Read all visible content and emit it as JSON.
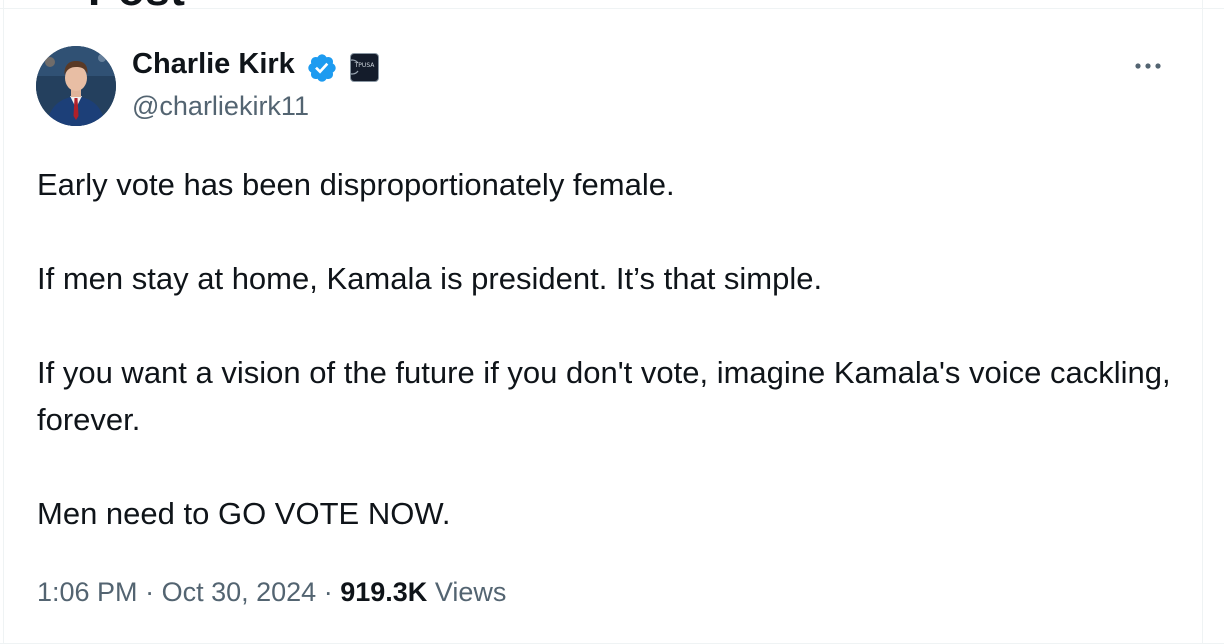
{
  "header": {
    "title": "Post"
  },
  "author": {
    "display_name": "Charlie Kirk",
    "handle": "@charliekirk11",
    "verified_icon": "verified-badge-icon",
    "affiliate_icon": "affiliate-badge-icon",
    "affiliate_badge_text": "TPUSA"
  },
  "actions": {
    "more_icon": "more-dots-icon"
  },
  "tweet": {
    "paragraphs": [
      "Early vote has been disproportionately female.",
      "If men stay at home, Kamala is president. It’s that simple.",
      "If you want a vision of the future if you don't vote, imagine Kamala's voice cackling, forever.",
      "Men need to GO VOTE NOW."
    ]
  },
  "meta": {
    "time": "1:06 PM",
    "separator": "·",
    "date": "Oct 30, 2024",
    "views_count": "919.3K",
    "views_label": "Views"
  },
  "colors": {
    "text_primary": "#0f1419",
    "text_secondary": "#536471",
    "verified_blue": "#1d9bf0",
    "border": "#eff3f4"
  }
}
